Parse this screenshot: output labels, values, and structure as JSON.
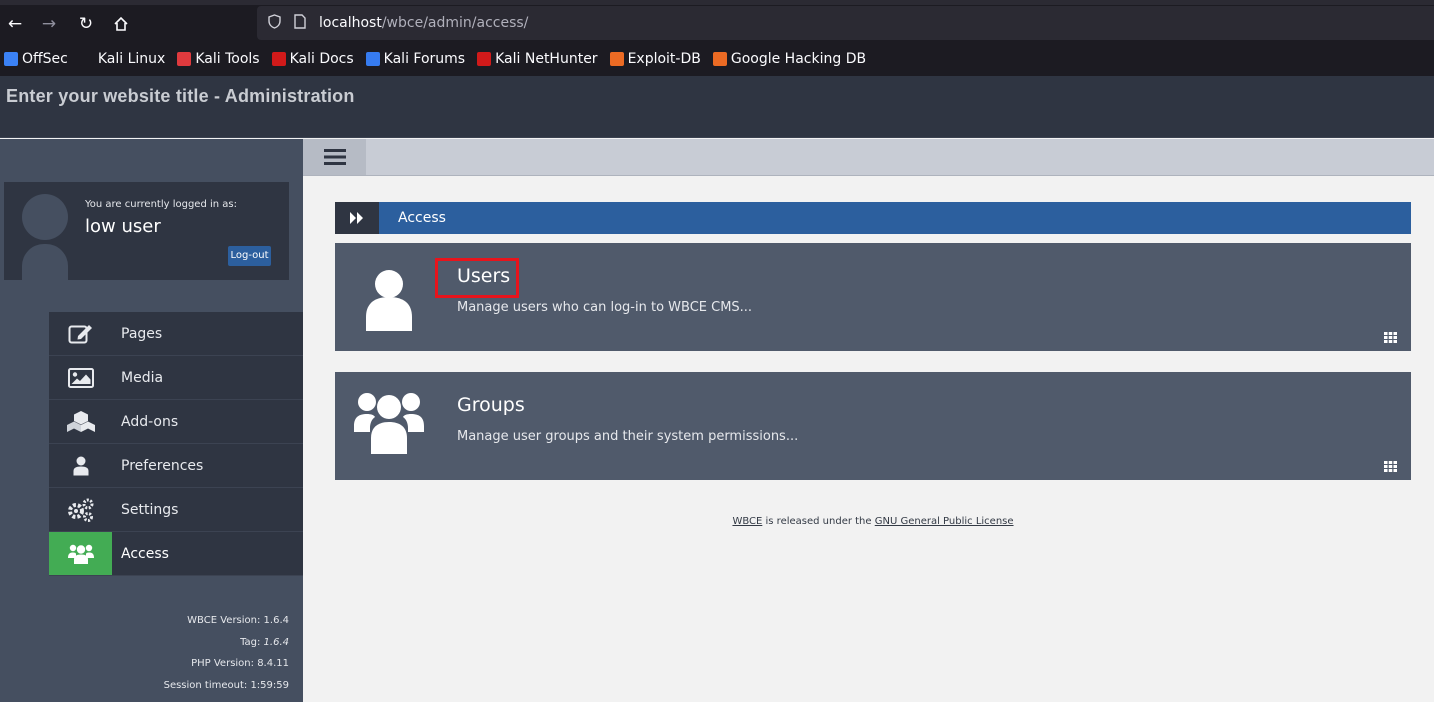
{
  "browser": {
    "url_host": "localhost",
    "url_path": "/wbce/admin/access/",
    "bookmarks": [
      {
        "label": "OffSec",
        "color": "#3b82f6"
      },
      {
        "label": "Kali Linux",
        "color": "#1c1b22"
      },
      {
        "label": "Kali Tools",
        "color": "#e03a3e"
      },
      {
        "label": "Kali Docs",
        "color": "#d11a1a"
      },
      {
        "label": "Kali Forums",
        "color": "#367bf0"
      },
      {
        "label": "Kali NetHunter",
        "color": "#d11a1a"
      },
      {
        "label": "Exploit-DB",
        "color": "#ec6b24"
      },
      {
        "label": "Google Hacking DB",
        "color": "#ec6b24"
      }
    ]
  },
  "header": {
    "title": "Enter your website title - Administration"
  },
  "user": {
    "logged_in_label": "You are currently logged in as:",
    "name": "low user",
    "logout_label": "Log-out"
  },
  "menu": {
    "items": [
      {
        "label": "Pages",
        "icon": "edit-icon"
      },
      {
        "label": "Media",
        "icon": "image-icon"
      },
      {
        "label": "Add-ons",
        "icon": "cubes-icon"
      },
      {
        "label": "Preferences",
        "icon": "user-icon"
      },
      {
        "label": "Settings",
        "icon": "gears-icon"
      },
      {
        "label": "Access",
        "icon": "users-icon",
        "active": true
      }
    ]
  },
  "meta": {
    "version": "WBCE Version: 1.6.4",
    "tag_label": "Tag: ",
    "tag_value": "1.6.4",
    "php": "PHP Version: 8.4.11",
    "session": "Session timeout: 1:59:59"
  },
  "breadcrumb": {
    "label": "Access"
  },
  "cards": [
    {
      "title": "Users",
      "description": "Manage users who can log-in to WBCE CMS..."
    },
    {
      "title": "Groups",
      "description": "Manage user groups and their system permissions..."
    }
  ],
  "footer": {
    "link1": "WBCE",
    "middle": " is released under the ",
    "link2": "GNU General Public License"
  },
  "colors": {
    "accent_blue": "#2c5f9e",
    "active_green": "#43ac54",
    "highlight_red": "#e8141c"
  }
}
